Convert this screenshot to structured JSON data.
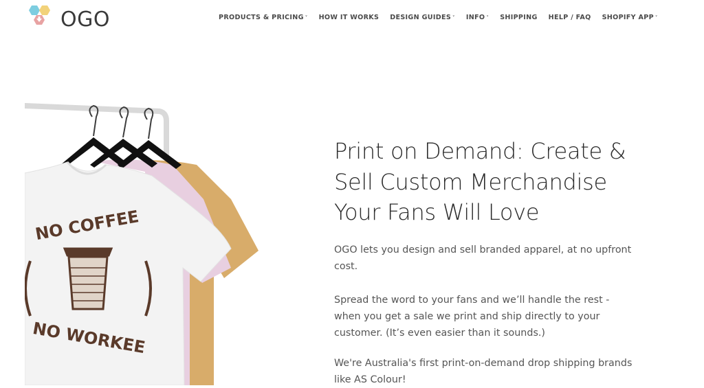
{
  "brand": {
    "logo_text": "OGO"
  },
  "nav": {
    "items": [
      {
        "label": "PRODUCTS & PRICING",
        "dropdown": true
      },
      {
        "label": "HOW IT WORKS",
        "dropdown": false
      },
      {
        "label": "DESIGN GUIDES",
        "dropdown": true
      },
      {
        "label": "INFO",
        "dropdown": true
      },
      {
        "label": "SHIPPING",
        "dropdown": false
      },
      {
        "label": "HELP / FAQ",
        "dropdown": false
      },
      {
        "label": "SHOPIFY APP",
        "dropdown": true
      }
    ],
    "chevron": "˅"
  },
  "hero": {
    "title_lines": [
      "Print on Demand: Create &",
      "Sell Custom Merchandise",
      "Your Fans Will Love"
    ],
    "paragraphs": [
      "OGO lets you design and sell branded apparel, at no upfront cost.",
      "Spread the word to your fans and we’ll handle the rest - when you get a sale we print and ship directly to your customer. (It’s even easier than it sounds.)",
      "We're Australia's first print-on-demand drop shipping brands like AS Colour!"
    ],
    "shirt_print": {
      "top": "NO COFFEE",
      "bottom": "NO WORKEE"
    }
  },
  "colors": {
    "logo_blue": "#7dcde0",
    "logo_yellow": "#f2d27a",
    "logo_red": "#e8a3a3",
    "shirt_white": "#f3f3f3",
    "shirt_pink": "#e8cfe0",
    "shirt_mustard": "#d8ac6a",
    "print_brown": "#5a3a2a"
  }
}
